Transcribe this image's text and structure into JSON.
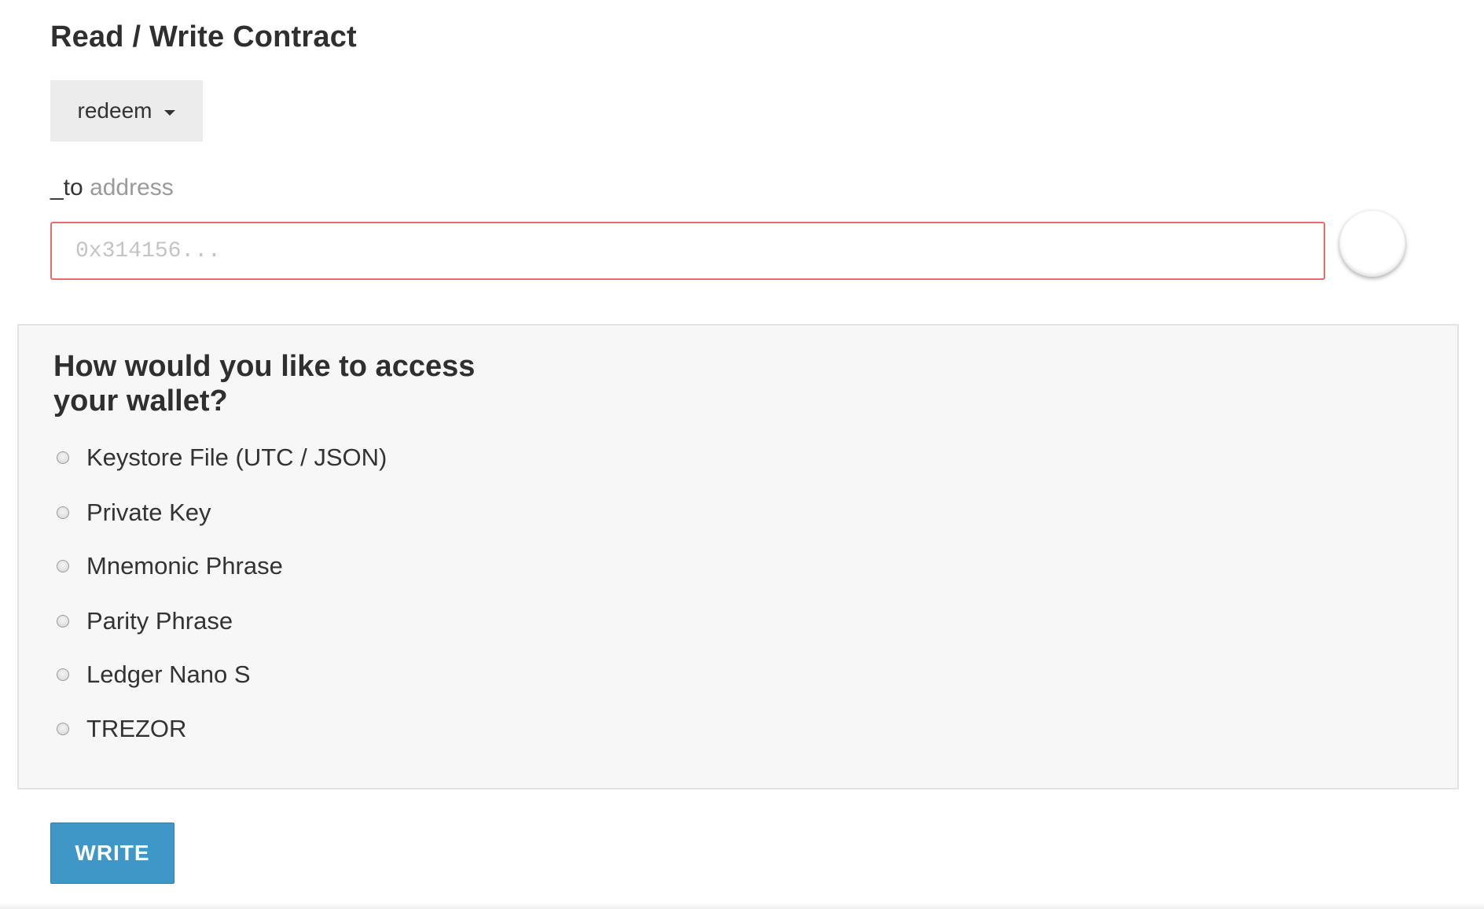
{
  "contract": {
    "title": "Read / Write Contract",
    "function_selector": {
      "selected": "redeem",
      "icon": "caret-down-icon"
    },
    "param": {
      "name": "_to",
      "type": "address",
      "placeholder": "0x314156...",
      "value": "",
      "state": "invalid",
      "border_color": "#e46d6d"
    }
  },
  "wallet": {
    "heading": "How would you like to access your wallet?",
    "options": [
      {
        "label": "Keystore File (UTC / JSON)",
        "selected": false
      },
      {
        "label": "Private Key",
        "selected": false
      },
      {
        "label": "Mnemonic Phrase",
        "selected": false
      },
      {
        "label": "Parity Phrase",
        "selected": false
      },
      {
        "label": "Ledger Nano S",
        "selected": false
      },
      {
        "label": "TREZOR",
        "selected": false
      }
    ]
  },
  "actions": {
    "write_label": "WRITE",
    "write_color": "#3f97c7"
  }
}
